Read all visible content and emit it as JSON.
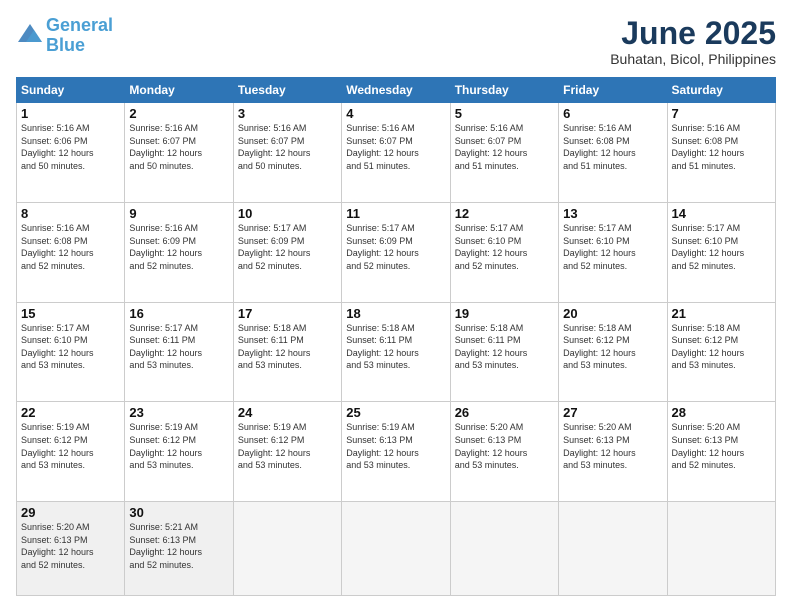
{
  "header": {
    "logo_line1": "General",
    "logo_line2": "Blue",
    "title": "June 2025",
    "location": "Buhatan, Bicol, Philippines"
  },
  "weekdays": [
    "Sunday",
    "Monday",
    "Tuesday",
    "Wednesday",
    "Thursday",
    "Friday",
    "Saturday"
  ],
  "weeks": [
    [
      {
        "day": "1",
        "info": "Sunrise: 5:16 AM\nSunset: 6:06 PM\nDaylight: 12 hours\nand 50 minutes."
      },
      {
        "day": "2",
        "info": "Sunrise: 5:16 AM\nSunset: 6:07 PM\nDaylight: 12 hours\nand 50 minutes."
      },
      {
        "day": "3",
        "info": "Sunrise: 5:16 AM\nSunset: 6:07 PM\nDaylight: 12 hours\nand 50 minutes."
      },
      {
        "day": "4",
        "info": "Sunrise: 5:16 AM\nSunset: 6:07 PM\nDaylight: 12 hours\nand 51 minutes."
      },
      {
        "day": "5",
        "info": "Sunrise: 5:16 AM\nSunset: 6:07 PM\nDaylight: 12 hours\nand 51 minutes."
      },
      {
        "day": "6",
        "info": "Sunrise: 5:16 AM\nSunset: 6:08 PM\nDaylight: 12 hours\nand 51 minutes."
      },
      {
        "day": "7",
        "info": "Sunrise: 5:16 AM\nSunset: 6:08 PM\nDaylight: 12 hours\nand 51 minutes."
      }
    ],
    [
      {
        "day": "8",
        "info": "Sunrise: 5:16 AM\nSunset: 6:08 PM\nDaylight: 12 hours\nand 52 minutes."
      },
      {
        "day": "9",
        "info": "Sunrise: 5:16 AM\nSunset: 6:09 PM\nDaylight: 12 hours\nand 52 minutes."
      },
      {
        "day": "10",
        "info": "Sunrise: 5:17 AM\nSunset: 6:09 PM\nDaylight: 12 hours\nand 52 minutes."
      },
      {
        "day": "11",
        "info": "Sunrise: 5:17 AM\nSunset: 6:09 PM\nDaylight: 12 hours\nand 52 minutes."
      },
      {
        "day": "12",
        "info": "Sunrise: 5:17 AM\nSunset: 6:10 PM\nDaylight: 12 hours\nand 52 minutes."
      },
      {
        "day": "13",
        "info": "Sunrise: 5:17 AM\nSunset: 6:10 PM\nDaylight: 12 hours\nand 52 minutes."
      },
      {
        "day": "14",
        "info": "Sunrise: 5:17 AM\nSunset: 6:10 PM\nDaylight: 12 hours\nand 52 minutes."
      }
    ],
    [
      {
        "day": "15",
        "info": "Sunrise: 5:17 AM\nSunset: 6:10 PM\nDaylight: 12 hours\nand 53 minutes."
      },
      {
        "day": "16",
        "info": "Sunrise: 5:17 AM\nSunset: 6:11 PM\nDaylight: 12 hours\nand 53 minutes."
      },
      {
        "day": "17",
        "info": "Sunrise: 5:18 AM\nSunset: 6:11 PM\nDaylight: 12 hours\nand 53 minutes."
      },
      {
        "day": "18",
        "info": "Sunrise: 5:18 AM\nSunset: 6:11 PM\nDaylight: 12 hours\nand 53 minutes."
      },
      {
        "day": "19",
        "info": "Sunrise: 5:18 AM\nSunset: 6:11 PM\nDaylight: 12 hours\nand 53 minutes."
      },
      {
        "day": "20",
        "info": "Sunrise: 5:18 AM\nSunset: 6:12 PM\nDaylight: 12 hours\nand 53 minutes."
      },
      {
        "day": "21",
        "info": "Sunrise: 5:18 AM\nSunset: 6:12 PM\nDaylight: 12 hours\nand 53 minutes."
      }
    ],
    [
      {
        "day": "22",
        "info": "Sunrise: 5:19 AM\nSunset: 6:12 PM\nDaylight: 12 hours\nand 53 minutes."
      },
      {
        "day": "23",
        "info": "Sunrise: 5:19 AM\nSunset: 6:12 PM\nDaylight: 12 hours\nand 53 minutes."
      },
      {
        "day": "24",
        "info": "Sunrise: 5:19 AM\nSunset: 6:12 PM\nDaylight: 12 hours\nand 53 minutes."
      },
      {
        "day": "25",
        "info": "Sunrise: 5:19 AM\nSunset: 6:13 PM\nDaylight: 12 hours\nand 53 minutes."
      },
      {
        "day": "26",
        "info": "Sunrise: 5:20 AM\nSunset: 6:13 PM\nDaylight: 12 hours\nand 53 minutes."
      },
      {
        "day": "27",
        "info": "Sunrise: 5:20 AM\nSunset: 6:13 PM\nDaylight: 12 hours\nand 53 minutes."
      },
      {
        "day": "28",
        "info": "Sunrise: 5:20 AM\nSunset: 6:13 PM\nDaylight: 12 hours\nand 52 minutes."
      }
    ],
    [
      {
        "day": "29",
        "info": "Sunrise: 5:20 AM\nSunset: 6:13 PM\nDaylight: 12 hours\nand 52 minutes."
      },
      {
        "day": "30",
        "info": "Sunrise: 5:21 AM\nSunset: 6:13 PM\nDaylight: 12 hours\nand 52 minutes."
      },
      {
        "day": "",
        "info": ""
      },
      {
        "day": "",
        "info": ""
      },
      {
        "day": "",
        "info": ""
      },
      {
        "day": "",
        "info": ""
      },
      {
        "day": "",
        "info": ""
      }
    ]
  ]
}
